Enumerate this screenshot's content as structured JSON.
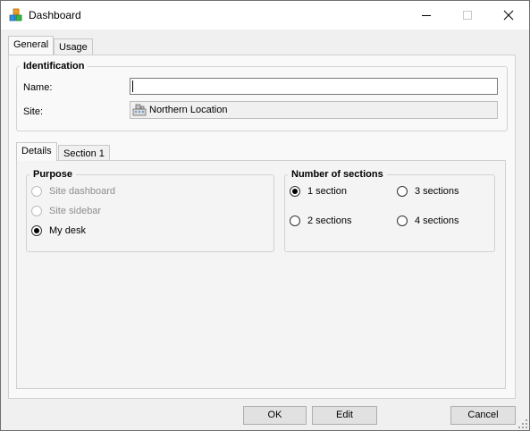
{
  "window": {
    "title": "Dashboard",
    "app_icon": "app-cubes-icon"
  },
  "tabs": [
    {
      "label": "General",
      "active": true
    },
    {
      "label": "Usage",
      "active": false
    }
  ],
  "identification": {
    "legend": "Identification",
    "name_label": "Name:",
    "name_value": "",
    "site_label": "Site:",
    "site_value": "Northern Location",
    "site_icon": "building-icon"
  },
  "inner_tabs": [
    {
      "label": "Details",
      "active": true
    },
    {
      "label": "Section 1",
      "active": false
    }
  ],
  "purpose": {
    "legend": "Purpose",
    "options": [
      {
        "label": "Site dashboard",
        "checked": false,
        "enabled": false
      },
      {
        "label": "Site sidebar",
        "checked": false,
        "enabled": false
      },
      {
        "label": "My desk",
        "checked": true,
        "enabled": true
      }
    ]
  },
  "sections": {
    "legend": "Number of sections",
    "options": [
      {
        "label": "1 section",
        "checked": true
      },
      {
        "label": "3 sections",
        "checked": false
      },
      {
        "label": "2 sections",
        "checked": false
      },
      {
        "label": "4 sections",
        "checked": false
      }
    ]
  },
  "buttons": {
    "ok": "OK",
    "edit": "Edit",
    "cancel": "Cancel"
  }
}
